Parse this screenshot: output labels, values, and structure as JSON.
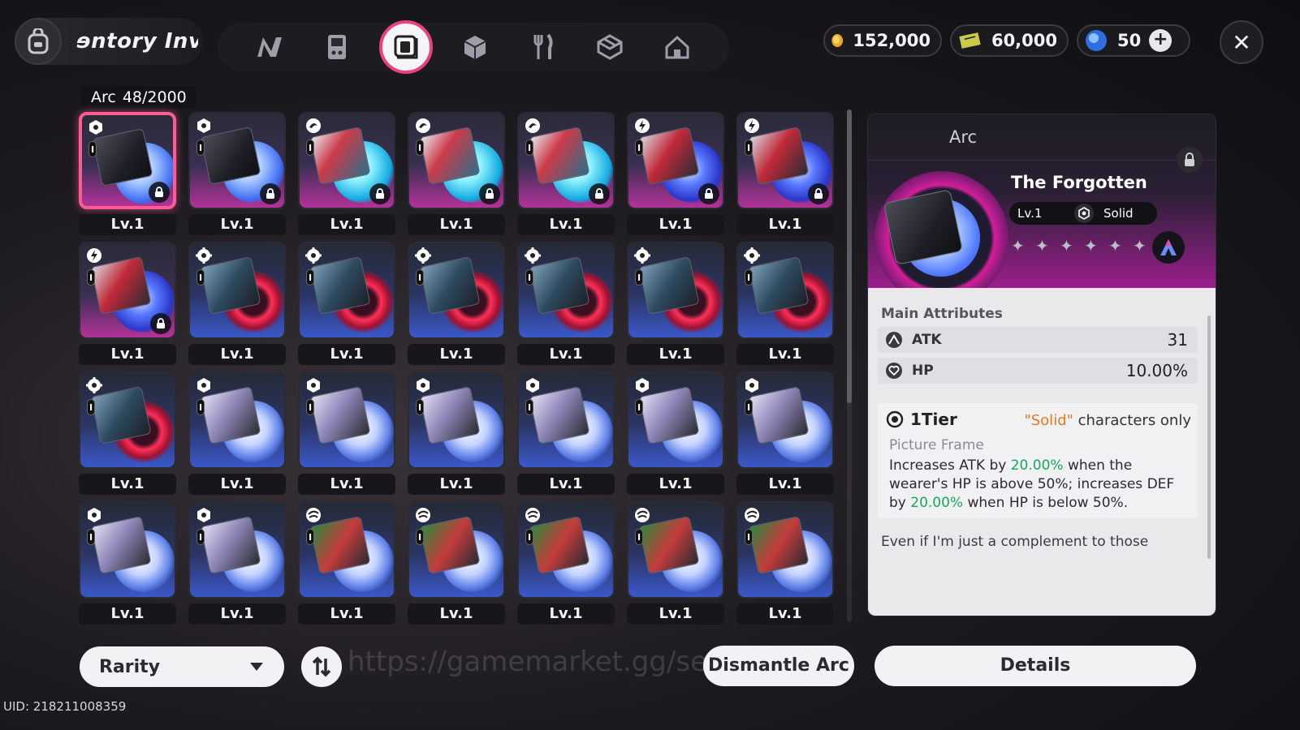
{
  "header": {
    "inventory_title": "ɘntory  Inv",
    "tabs": [
      {
        "icon": "n-logo-icon",
        "active": false
      },
      {
        "icon": "gameboy-icon",
        "active": false
      },
      {
        "icon": "arc-disc-icon",
        "active": true
      },
      {
        "icon": "cube-icon",
        "active": false
      },
      {
        "icon": "fork-knife-icon",
        "active": false
      },
      {
        "icon": "box-icon",
        "active": false
      },
      {
        "icon": "home-icon",
        "active": false
      }
    ],
    "currencies": [
      {
        "icon": "gold-coin-icon",
        "value": "152,000"
      },
      {
        "icon": "ticket-icon",
        "value": "60,000"
      },
      {
        "icon": "crystal-icon",
        "value": "50"
      }
    ],
    "close": "✕"
  },
  "grid": {
    "label": "Arc",
    "count": "48/2000",
    "items": [
      {
        "level": "Lv.1",
        "type": "hex",
        "art": "dark",
        "orb": "blueorb",
        "frame": "purple",
        "locked": true,
        "selected": true
      },
      {
        "level": "Lv.1",
        "type": "hex",
        "art": "dark",
        "orb": "blueorb",
        "frame": "purple",
        "locked": true,
        "selected": false
      },
      {
        "level": "Lv.1",
        "type": "swirl",
        "art": "cyan",
        "orb": "cyan",
        "frame": "purple",
        "locked": true,
        "selected": false
      },
      {
        "level": "Lv.1",
        "type": "swirl",
        "art": "cyan",
        "orb": "cyan",
        "frame": "purple",
        "locked": true,
        "selected": false
      },
      {
        "level": "Lv.1",
        "type": "swirl",
        "art": "cyan",
        "orb": "cyan",
        "frame": "purple",
        "locked": true,
        "selected": false
      },
      {
        "level": "Lv.1",
        "type": "bolt",
        "art": "red",
        "orb": "lightning",
        "frame": "purple",
        "locked": true,
        "selected": false
      },
      {
        "level": "Lv.1",
        "type": "bolt",
        "art": "red",
        "orb": "lightning",
        "frame": "purple",
        "locked": true,
        "selected": false
      },
      {
        "level": "Lv.1",
        "type": "bolt",
        "art": "red",
        "orb": "lightning",
        "frame": "purple",
        "locked": true,
        "selected": false
      },
      {
        "level": "Lv.1",
        "type": "gear",
        "art": "hex",
        "orb": "red",
        "frame": "blue",
        "locked": false,
        "selected": false
      },
      {
        "level": "Lv.1",
        "type": "gear",
        "art": "hex",
        "orb": "red",
        "frame": "blue",
        "locked": false,
        "selected": false
      },
      {
        "level": "Lv.1",
        "type": "gear",
        "art": "hex",
        "orb": "red",
        "frame": "blue",
        "locked": false,
        "selected": false
      },
      {
        "level": "Lv.1",
        "type": "gear",
        "art": "hex",
        "orb": "red",
        "frame": "blue",
        "locked": false,
        "selected": false
      },
      {
        "level": "Lv.1",
        "type": "gear",
        "art": "hex",
        "orb": "red",
        "frame": "blue",
        "locked": false,
        "selected": false
      },
      {
        "level": "Lv.1",
        "type": "gear",
        "art": "hex",
        "orb": "red",
        "frame": "blue",
        "locked": false,
        "selected": false
      },
      {
        "level": "Lv.1",
        "type": "gear",
        "art": "hex",
        "orb": "red",
        "frame": "blue",
        "locked": false,
        "selected": false
      },
      {
        "level": "Lv.1",
        "type": "hex",
        "art": "lilac",
        "orb": "white",
        "frame": "blue",
        "locked": false,
        "selected": false
      },
      {
        "level": "Lv.1",
        "type": "hex",
        "art": "lilac",
        "orb": "white",
        "frame": "blue",
        "locked": false,
        "selected": false
      },
      {
        "level": "Lv.1",
        "type": "hex",
        "art": "lilac",
        "orb": "white",
        "frame": "blue",
        "locked": false,
        "selected": false
      },
      {
        "level": "Lv.1",
        "type": "hex",
        "art": "lilac",
        "orb": "white",
        "frame": "blue",
        "locked": false,
        "selected": false
      },
      {
        "level": "Lv.1",
        "type": "hex",
        "art": "lilac",
        "orb": "white",
        "frame": "blue",
        "locked": false,
        "selected": false
      },
      {
        "level": "Lv.1",
        "type": "hex",
        "art": "lilac",
        "orb": "white",
        "frame": "blue",
        "locked": false,
        "selected": false
      },
      {
        "level": "Lv.1",
        "type": "hex",
        "art": "lilac",
        "orb": "white",
        "frame": "blue",
        "locked": false,
        "selected": false
      },
      {
        "level": "Lv.1",
        "type": "hex",
        "art": "lilac",
        "orb": "white",
        "frame": "blue",
        "locked": false,
        "selected": false
      },
      {
        "level": "Lv.1",
        "type": "wind",
        "art": "green",
        "orb": "white",
        "frame": "blue",
        "locked": false,
        "selected": false
      },
      {
        "level": "Lv.1",
        "type": "wind",
        "art": "green",
        "orb": "white",
        "frame": "blue",
        "locked": false,
        "selected": false
      },
      {
        "level": "Lv.1",
        "type": "wind",
        "art": "green",
        "orb": "white",
        "frame": "blue",
        "locked": false,
        "selected": false
      },
      {
        "level": "Lv.1",
        "type": "wind",
        "art": "green",
        "orb": "white",
        "frame": "blue",
        "locked": false,
        "selected": false
      },
      {
        "level": "Lv.1",
        "type": "wind",
        "art": "green",
        "orb": "white",
        "frame": "blue",
        "locked": false,
        "selected": false
      }
    ]
  },
  "detail": {
    "category": "Arc",
    "name": "The Forgotten",
    "level": "Lv.1",
    "attribute": "Solid",
    "stars": [
      "✦",
      "✦",
      "✦",
      "✦",
      "✦",
      "✦"
    ],
    "main_attributes_title": "Main Attributes",
    "attributes": [
      {
        "name": "ATK",
        "value": "31",
        "icon": "sword-icon"
      },
      {
        "name": "HP",
        "value": "10.00%",
        "icon": "heart-icon"
      }
    ],
    "tier_label": "1Tier",
    "restriction_highlight": "\"Solid\"",
    "restriction_rest": " characters only",
    "passive_name": "Picture Frame",
    "passive_parts": [
      "Increases ATK by ",
      "20.00%",
      " when the wearer's HP is above 50%; increases DEF by ",
      "20.00%",
      " when HP is below 50%."
    ],
    "flavor": "Even if I'm just a complement to those"
  },
  "footer": {
    "sort_label": "Rarity",
    "watermark": "https://gamemarket.gg/se  News",
    "dismantle_label": "Dismantle Arc",
    "details_label": "Details",
    "uid": "UID: 218211008359"
  },
  "colors": {
    "accent": "#e8437b",
    "selected_border": "#ff5c96",
    "highlight_green": "#1aa65a",
    "highlight_orange": "#e07820"
  }
}
